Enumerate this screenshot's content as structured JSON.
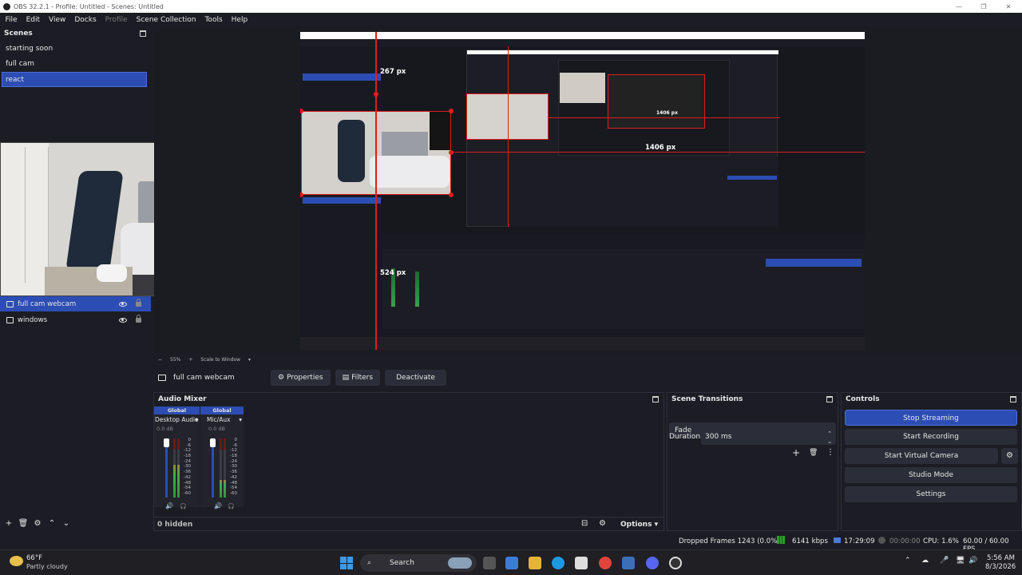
{
  "window": {
    "title": "OBS 32.2.1 - Profile: Untitled - Scenes: Untitled"
  },
  "menu": [
    "File",
    "Edit",
    "View",
    "Docks",
    "Profile",
    "Scene Collection",
    "Tools",
    "Help"
  ],
  "scenes": {
    "title": "Scenes",
    "items": [
      {
        "label": "starting soon"
      },
      {
        "label": "full cam"
      },
      {
        "label": "react"
      }
    ]
  },
  "sources": {
    "items": [
      {
        "label": "full cam webcam",
        "icon": "camera-icon"
      },
      {
        "label": "windows",
        "icon": "window-icon"
      }
    ]
  },
  "preview": {
    "measure_top": "267 px",
    "measure_right": "1406 px",
    "measure_bottom": "524 px",
    "inner_measure_right": "1406 px",
    "zoom": "55%",
    "scale_mode": "Scale to Window"
  },
  "context": {
    "source_name": "full cam webcam",
    "properties": "Properties",
    "filters": "Filters",
    "deactivate": "Deactivate"
  },
  "mixer": {
    "title": "Audio Mixer",
    "channels": [
      {
        "scope": "Global",
        "name": "Desktop Audio",
        "db": "0.0 dB",
        "level": 0.55
      },
      {
        "scope": "Global",
        "name": "Mic/Aux",
        "db": "0.0 dB",
        "level": 0.3
      }
    ],
    "scale": [
      "0",
      "-6",
      "-12",
      "-18",
      "-24",
      "-30",
      "-36",
      "-42",
      "-48",
      "-54",
      "-60"
    ],
    "hidden": "0 hidden",
    "options": "Options"
  },
  "transitions": {
    "title": "Scene Transitions",
    "type": "Fade",
    "duration_label": "Duration",
    "duration": "300 ms"
  },
  "controls": {
    "title": "Controls",
    "stop_streaming": "Stop Streaming",
    "start_recording": "Start Recording",
    "start_virtual_camera": "Start Virtual Camera",
    "studio_mode": "Studio Mode",
    "settings": "Settings"
  },
  "status": {
    "dropped": "Dropped Frames 1243 (0.0%)",
    "kbps": "6141 kbps",
    "stream_time": "17:29:09",
    "rec_time": "00:00:00",
    "cpu": "CPU: 1.6%",
    "fps": "60.00 / 60.00 FPS"
  },
  "taskbar": {
    "weather_temp": "66°F",
    "weather_desc": "Partly cloudy",
    "search": "Search",
    "time": "5:56 AM",
    "date": "8/3/2026"
  },
  "colors": {
    "accent": "#2c4db3",
    "red_guide": "#e01c1c",
    "bg": "#1c1d24"
  }
}
